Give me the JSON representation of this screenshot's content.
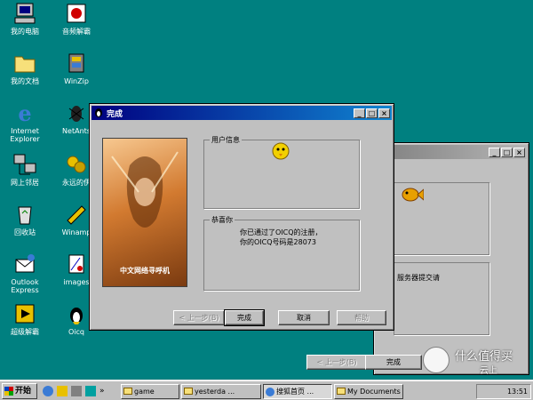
{
  "desktop": {
    "icons_col1": [
      {
        "label": "我的电脑",
        "icon": "my-computer-icon"
      },
      {
        "label": "我的文档",
        "icon": "my-documents-icon"
      },
      {
        "label": "Internet\nExplorer",
        "icon": "internet-explorer-icon"
      },
      {
        "label": "网上邻居",
        "icon": "network-neighborhood-icon"
      },
      {
        "label": "回收站",
        "icon": "recycle-bin-icon"
      },
      {
        "label": "Outlook\nExpress",
        "icon": "outlook-express-icon"
      },
      {
        "label": "超级解霸",
        "icon": "super-jieba-icon"
      }
    ],
    "icons_col2": [
      {
        "label": "音频解霸",
        "icon": "audio-jieba-icon"
      },
      {
        "label": "WinZip",
        "icon": "winzip-icon"
      },
      {
        "label": "NetAnts",
        "icon": "netants-icon"
      },
      {
        "label": "永远的伊",
        "icon": "yongyuan-icon"
      },
      {
        "label": "Winamp",
        "icon": "winamp-icon"
      },
      {
        "label": "images",
        "icon": "images-icon"
      },
      {
        "label": "Oicq",
        "icon": "oicq-icon"
      }
    ]
  },
  "dialog_front": {
    "title": "完成",
    "banner_text": "中文网络寻呼机",
    "group_user_info": "用户信息",
    "group_congrats": "恭喜你",
    "congrats_text": "你已通过了OICQ的注册，你的OICQ号码是28073",
    "buttons": {
      "back": "< 上一步(B)",
      "finish": "完成",
      "cancel": "取消",
      "help": "帮助"
    }
  },
  "dialog_back": {
    "server_text": "服务器提交请",
    "buttons": {
      "back": "< 上一步(B)",
      "finish": "完成"
    }
  },
  "taskbar": {
    "start_label": "开始",
    "tasks": [
      "game",
      "yesterda ...",
      "搜狐首页 ...",
      "My Documents"
    ],
    "clock": "13:51"
  },
  "watermark": {
    "text": "什么值得买",
    "sub": "云上"
  },
  "colors": {
    "desktop": "#008080",
    "title_active": "#000080",
    "face": "#c0c0c0"
  }
}
